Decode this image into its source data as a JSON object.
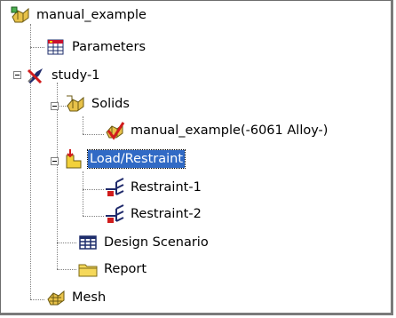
{
  "tree": {
    "root": {
      "label": "manual_example",
      "icon": "part-icon"
    },
    "parameters": {
      "label": "Parameters",
      "icon": "parameters-icon"
    },
    "study": {
      "label": "study-1",
      "icon": "study-icon",
      "expanded": true
    },
    "solids": {
      "label": "Solids",
      "icon": "solids-icon",
      "expanded": true
    },
    "solid_body": {
      "label": "manual_example(-6061 Alloy-)",
      "icon": "solid-body-icon"
    },
    "load_restraint": {
      "label": "Load/Restraint",
      "icon": "load-restraint-icon",
      "expanded": true,
      "selected": true
    },
    "restraint_1": {
      "label": "Restraint-1",
      "icon": "restraint-icon"
    },
    "restraint_2": {
      "label": "Restraint-2",
      "icon": "restraint-icon"
    },
    "design_scenario": {
      "label": "Design Scenario",
      "icon": "design-scenario-icon"
    },
    "report": {
      "label": "Report",
      "icon": "report-folder-icon"
    },
    "mesh": {
      "label": "Mesh",
      "icon": "mesh-icon"
    }
  },
  "colors": {
    "selection": "#316ac5",
    "tree_lines": "#808080"
  }
}
